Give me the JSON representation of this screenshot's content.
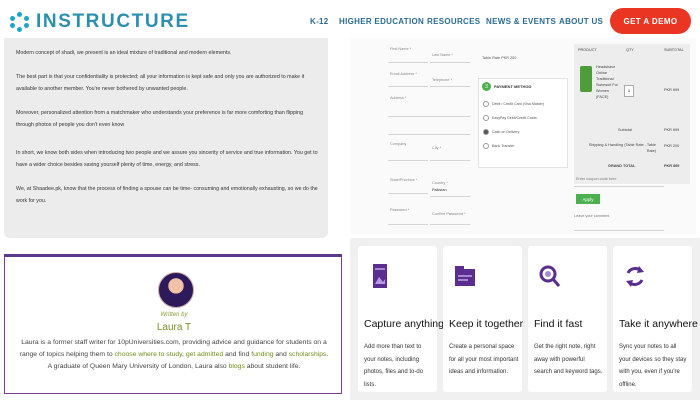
{
  "header": {
    "logo_text": "INSTRUCTURE",
    "nav": [
      "K-12",
      "HIGHER EDUCATION",
      "RESOURCES",
      "NEWS & EVENTS",
      "ABOUT US"
    ],
    "cta": "GET A DEMO",
    "accent": "#2a6c93",
    "cta_color": "#ea3523"
  },
  "article": {
    "paragraphs": [
      "Modern concept of shadi, we present is an ideal mixture of traditional and modern elements.",
      "The best part is that your confidentiality is protected; all your information is kept safe and only you are authorized to make it available to another member. You're never bothered by unwanted people.",
      "Moreover, personalized attention from a matchmaker who understands your preference is far more comforting than flipping through photos of people you don't even know",
      "In short, we know both sides when introducing two people and we assure you sincerity of service and true information. You get to have a wider choice besides saving yourself plenty of time, energy, and stress.",
      "We, at Shaadee.pk, know that the process of finding a spouse can be time- consuming and emotionally exhausting, so we do the work for you."
    ]
  },
  "checkout": {
    "fields": [
      "First Name *",
      "Last Name *",
      "Email Address *",
      "Telephone *",
      "Address *",
      "Company",
      "City *",
      "State/Province *",
      "Country *",
      "Password *",
      "Confirm Password *"
    ],
    "country_value": "Pakistan",
    "table_rate": "Table Rate PKR 200",
    "payment_step": "3",
    "payment_title": "PAYMENT METHOD",
    "payment_options": [
      "Debit / Credit Card (Visa Master)",
      "EasyPay Debit/Credit Cards",
      "Cash on Delivery",
      "Bank Transfer"
    ],
    "cart_headers": [
      "PRODUCT",
      "QTY",
      "SUBTOTAL"
    ],
    "product_name": "Headshave Online Traditional Swimsuit For Women (FACE)",
    "qty": "1",
    "product_price": "PKR 699",
    "subtotal_label": "Subtotal",
    "subtotal_value": "PKR 699",
    "shipping_label": "Shipping & Handling (Table Rate - Table Rate)",
    "shipping_value": "PKR 200",
    "grand_total_label": "GRAND TOTAL",
    "grand_total_value": "PKR 899",
    "coupon_placeholder": "Enter coupon code here",
    "apply_label": "Apply",
    "comment_label": "Leave your comment"
  },
  "author": {
    "by": "Written by",
    "name": "Laura T",
    "bio_parts": [
      "Laura is a former staff writer for 10pUniversities.com, providing advice and guidance for students on a range of topics helping them to ",
      "choose where to study",
      ", ",
      "get admitted",
      " and find ",
      "funding",
      " and ",
      "scholarships",
      ". A graduate of Queen Mary University of London, Laura also ",
      "blogs",
      " about student life."
    ]
  },
  "features": [
    {
      "title": "Capture anything",
      "desc": "Add more than text to your notes, including photos, files and to-do lists.",
      "icon": "capture-icon"
    },
    {
      "title": "Keep it together",
      "desc": "Create a personal space for all your most important ideas and information.",
      "icon": "folder-icon"
    },
    {
      "title": "Find it fast",
      "desc": "Get the right note, right away with powerful search and keyword tags.",
      "icon": "search-icon"
    },
    {
      "title": "Take it anywhere",
      "desc": "Sync your notes to all your devices so they stay with you, even if you're offline.",
      "icon": "sync-icon"
    }
  ]
}
